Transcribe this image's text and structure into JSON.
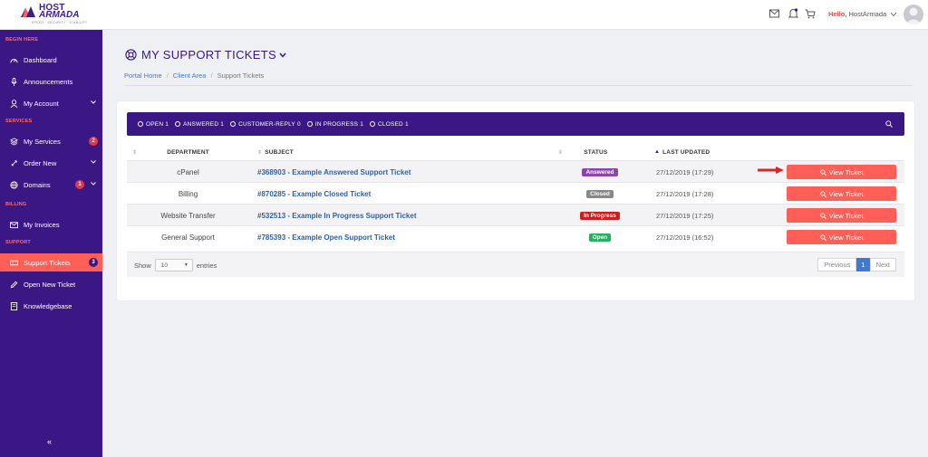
{
  "brand": {
    "name_top": "HOST",
    "name_bottom": "ARMADA",
    "tagline": "SPEED · SECURITY · STABILITY"
  },
  "header": {
    "hello_label": "Hello,",
    "user_name": "HostArmada",
    "icons": [
      "mail-icon",
      "bell-icon",
      "cart-icon",
      "chevron-down-icon"
    ]
  },
  "sidebar": {
    "sections": [
      {
        "label": "BEGIN HERE"
      },
      {
        "label": "SERVICES"
      },
      {
        "label": "BILLING"
      },
      {
        "label": "SUPPORT"
      }
    ],
    "items": [
      {
        "label": "Dashboard",
        "icon": "dashboard-icon"
      },
      {
        "label": "Announcements",
        "icon": "microphone-icon"
      },
      {
        "label": "My Account",
        "icon": "user-icon"
      },
      {
        "label": "My Services",
        "icon": "layers-icon",
        "badge": "2"
      },
      {
        "label": "Order New",
        "icon": "rocket-icon"
      },
      {
        "label": "Domains",
        "icon": "globe-icon",
        "badge": "1"
      },
      {
        "label": "My Invoices",
        "icon": "envelope-icon"
      },
      {
        "label": "Support Tickets",
        "icon": "ticket-icon",
        "badge": "3"
      },
      {
        "label": "Open New Ticket",
        "icon": "pencil-icon"
      },
      {
        "label": "Knowledgebase",
        "icon": "book-icon"
      }
    ],
    "collapse_label": "«"
  },
  "page": {
    "title": "MY SUPPORT TICKETS",
    "breadcrumb": [
      "Portal Home",
      "Client Area",
      "Support Tickets"
    ]
  },
  "filters": [
    {
      "label": "OPEN",
      "count": "1"
    },
    {
      "label": "ANSWERED",
      "count": "1"
    },
    {
      "label": "CUSTOMER-REPLY",
      "count": "0"
    },
    {
      "label": "IN PROGRESS",
      "count": "1"
    },
    {
      "label": "CLOSED",
      "count": "1"
    }
  ],
  "table": {
    "headers": {
      "department": "DEPARTMENT",
      "subject": "SUBJECT",
      "status": "STATUS",
      "last_updated": "LAST UPDATED"
    },
    "rows": [
      {
        "department": "cPanel",
        "subject": "#368903 - Example Answered Support Ticket",
        "status": "Answered",
        "status_color": "#8e44ad",
        "updated": "27/12/2019 (17:29)",
        "action": "View Ticket"
      },
      {
        "department": "Billing",
        "subject": "#870285 - Example Closed Ticket",
        "status": "Closed",
        "status_color": "#888888",
        "updated": "27/12/2019 (17:28)",
        "action": "View Ticket"
      },
      {
        "department": "Website Transfer",
        "subject": "#532513 - Example In Progress Support Ticket",
        "status": "In Progress",
        "status_color": "#cc1f1f",
        "updated": "27/12/2019 (17:25)",
        "action": "View Ticket"
      },
      {
        "department": "General Support",
        "subject": "#785393 - Example Open Support Ticket",
        "status": "Open",
        "status_color": "#27ae60",
        "updated": "27/12/2019 (16:52)",
        "action": "View Ticket"
      }
    ]
  },
  "footer": {
    "show_label": "Show",
    "entries_value": "10",
    "entries_label": "entries",
    "prev": "Previous",
    "page": "1",
    "next": "Next"
  },
  "colors": {
    "sidebar": "#3b1685",
    "accent": "#ff5f57",
    "link": "#2d5fa8"
  }
}
